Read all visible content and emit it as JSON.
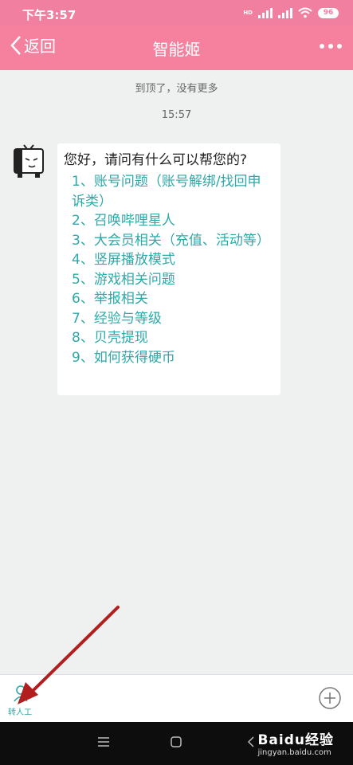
{
  "status_bar": {
    "time": "下午3:57",
    "network": "HD",
    "battery": "96"
  },
  "nav": {
    "back_label": "返回",
    "title": "智能姬"
  },
  "chat": {
    "notice": "到顶了，没有更多",
    "timestamp": "15:57",
    "greeting": "您好，请问有什么可以帮您的?",
    "options": [
      "1、账号问题（账号解绑/找回申诉类）",
      "2、召唤哔哩星人",
      "3、大会员相关（充值、活动等）",
      "4、竖屏播放模式",
      "5、游戏相关问题",
      "6、举报相关",
      "7、经验与等级",
      "8、贝壳提现",
      "9、如何获得硬币"
    ]
  },
  "bottom": {
    "transfer_label": "转人工"
  },
  "watermark": {
    "brand": "Baidu经验",
    "url": "jingyan.baidu.com"
  },
  "colors": {
    "header": "#f5819f",
    "link": "#2ea8a8",
    "background": "#eef1f0",
    "arrow": "#b21e1e"
  }
}
